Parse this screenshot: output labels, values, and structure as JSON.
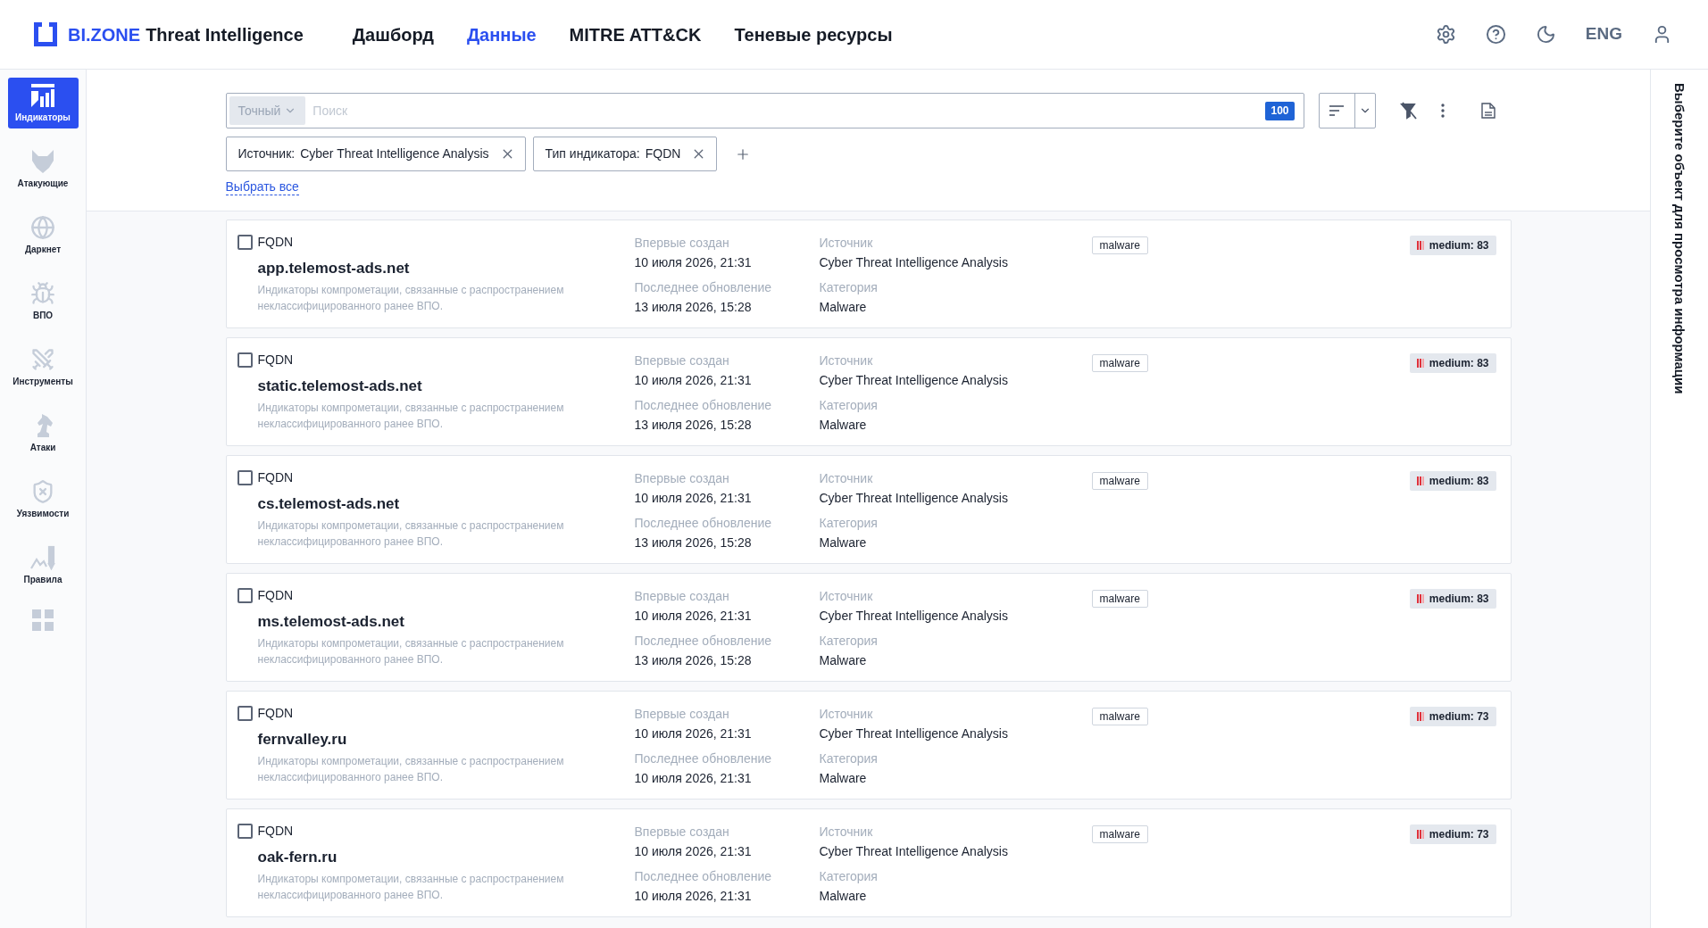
{
  "header": {
    "brand": {
      "name": "BI.ZONE",
      "product": "Threat Intelligence"
    },
    "nav": [
      {
        "label": "Дашборд",
        "selected": false
      },
      {
        "label": "Данные",
        "selected": true
      },
      {
        "label": "MITRE ATT&CK",
        "selected": false
      },
      {
        "label": "Теневые ресурсы",
        "selected": false
      }
    ],
    "language": "ENG"
  },
  "sidebar": {
    "items": [
      {
        "label": "Индикаторы",
        "selected": true
      },
      {
        "label": "Атакующие",
        "selected": false
      },
      {
        "label": "Даркнет",
        "selected": false
      },
      {
        "label": "ВПО",
        "selected": false
      },
      {
        "label": "Инструменты",
        "selected": false
      },
      {
        "label": "Атаки",
        "selected": false
      },
      {
        "label": "Уязвимости",
        "selected": false
      },
      {
        "label": "Правила",
        "selected": false
      }
    ]
  },
  "search": {
    "mode": "Точный",
    "placeholder": "Поиск",
    "count": "100"
  },
  "filters": [
    {
      "label": "Источник:",
      "value": "Cyber Threat Intelligence Analysis"
    },
    {
      "label": "Тип индикатора:",
      "value": "FQDN"
    }
  ],
  "select_all": "Выбрать все",
  "indicators": [
    {
      "checked": false,
      "type": "FQDN",
      "value": "app.telemost-ads.net",
      "description": "Индикаторы компрометации, связанные с распространением неклассифицированного ранее ВПО.",
      "created_label": "Впервые создан",
      "created": "10 июля 2026, 21:31",
      "updated_label": "Последнее обновление",
      "updated": "13 июля 2026, 15:28",
      "source_label": "Источник",
      "source": "Cyber Threat Intelligence Analysis",
      "category_label": "Категория",
      "category": "Malware",
      "tags": [
        "malware"
      ],
      "severity": "medium: 83"
    },
    {
      "checked": false,
      "type": "FQDN",
      "value": "static.telemost-ads.net",
      "description": "Индикаторы компрометации, связанные с распространением неклассифицированного ранее ВПО.",
      "created_label": "Впервые создан",
      "created": "10 июля 2026, 21:31",
      "updated_label": "Последнее обновление",
      "updated": "13 июля 2026, 15:28",
      "source_label": "Источник",
      "source": "Cyber Threat Intelligence Analysis",
      "category_label": "Категория",
      "category": "Malware",
      "tags": [
        "malware"
      ],
      "severity": "medium: 83"
    },
    {
      "checked": false,
      "type": "FQDN",
      "value": "cs.telemost-ads.net",
      "description": "Индикаторы компрометации, связанные с распространением неклассифицированного ранее ВПО.",
      "created_label": "Впервые создан",
      "created": "10 июля 2026, 21:31",
      "updated_label": "Последнее обновление",
      "updated": "13 июля 2026, 15:28",
      "source_label": "Источник",
      "source": "Cyber Threat Intelligence Analysis",
      "category_label": "Категория",
      "category": "Malware",
      "tags": [
        "malware"
      ],
      "severity": "medium: 83"
    },
    {
      "checked": false,
      "type": "FQDN",
      "value": "ms.telemost-ads.net",
      "description": "Индикаторы компрометации, связанные с распространением неклассифицированного ранее ВПО.",
      "created_label": "Впервые создан",
      "created": "10 июля 2026, 21:31",
      "updated_label": "Последнее обновление",
      "updated": "13 июля 2026, 15:28",
      "source_label": "Источник",
      "source": "Cyber Threat Intelligence Analysis",
      "category_label": "Категория",
      "category": "Malware",
      "tags": [
        "malware"
      ],
      "severity": "medium: 83"
    },
    {
      "checked": false,
      "type": "FQDN",
      "value": "fernvalley.ru",
      "description": "Индикаторы компрометации, связанные с распространением неклассифицированного ранее ВПО.",
      "created_label": "Впервые создан",
      "created": "10 июля 2026, 21:31",
      "updated_label": "Последнее обновление",
      "updated": "10 июля 2026, 21:31",
      "source_label": "Источник",
      "source": "Cyber Threat Intelligence Analysis",
      "category_label": "Категория",
      "category": "Malware",
      "tags": [
        "malware"
      ],
      "severity": "medium: 73"
    },
    {
      "checked": false,
      "type": "FQDN",
      "value": "oak-fern.ru",
      "description": "Индикаторы компрометации, связанные с распространением неклассифицированного ранее ВПО.",
      "created_label": "Впервые создан",
      "created": "10 июля 2026, 21:31",
      "updated_label": "Последнее обновление",
      "updated": "10 июля 2026, 21:31",
      "source_label": "Источник",
      "source": "Cyber Threat Intelligence Analysis",
      "category_label": "Категория",
      "category": "Malware",
      "tags": [
        "malware"
      ],
      "severity": "medium: 73"
    }
  ],
  "details_panel": {
    "hint": "Выберите объект для просмотра информации"
  }
}
